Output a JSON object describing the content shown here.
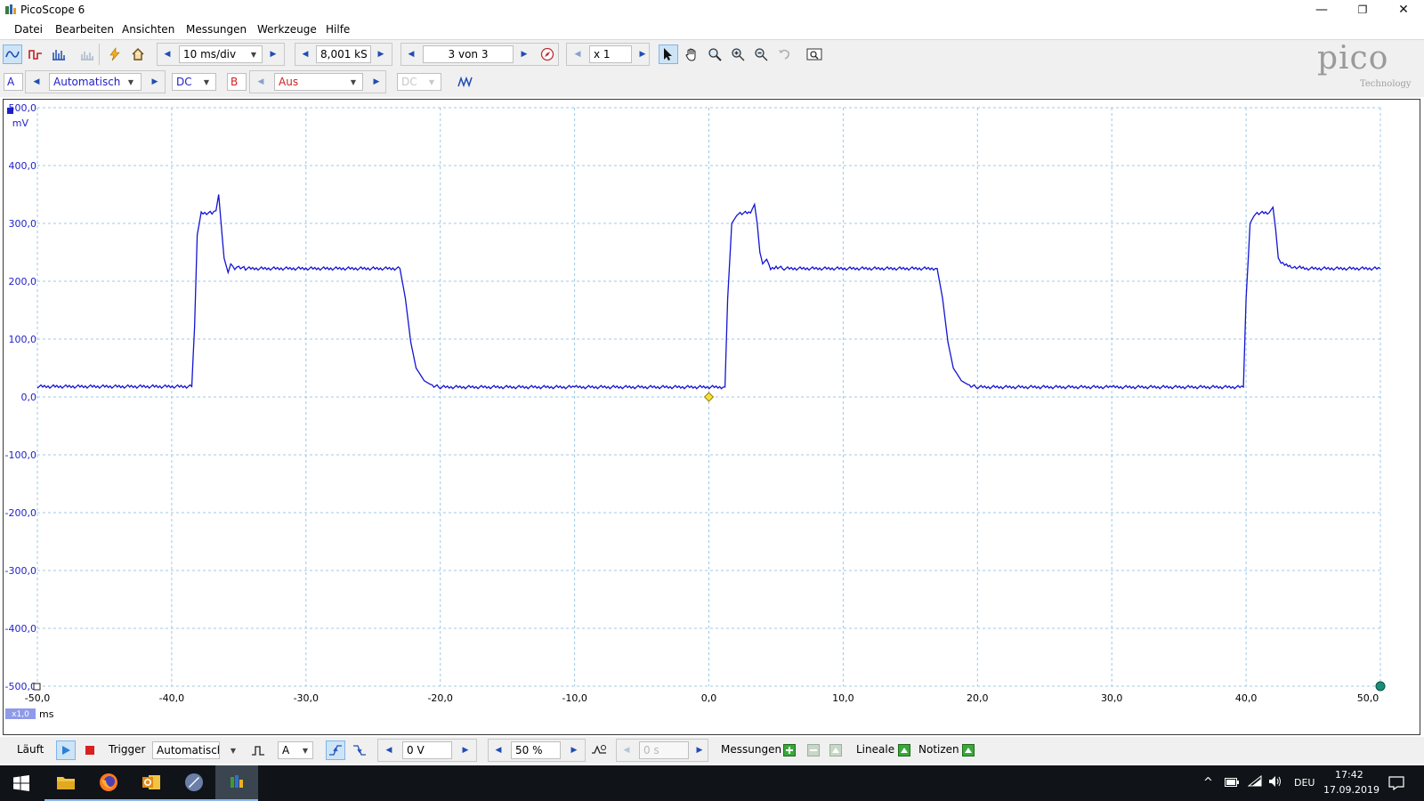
{
  "window": {
    "title": "PicoScope 6"
  },
  "menu": [
    "Datei",
    "Bearbeiten",
    "Ansichten",
    "Messungen",
    "Werkzeuge",
    "Hilfe"
  ],
  "toolbar": {
    "timebase": "10 ms/div",
    "samples": "8,001 kS",
    "buffer": "3 von 3",
    "zoom": "x 1"
  },
  "channels": {
    "a": {
      "label": "A",
      "range": "Automatisch",
      "coupling": "DC",
      "color": "#1f1fc8"
    },
    "b": {
      "label": "B",
      "range": "Aus",
      "coupling": "DC",
      "color": "#d02020"
    }
  },
  "logo": {
    "main": "pico",
    "sub": "Technology"
  },
  "chart_data": {
    "type": "line",
    "ylabel": "mV",
    "xlabel": "ms",
    "xlim": [
      -50,
      50
    ],
    "ylim": [
      -500,
      500
    ],
    "x_ticks": [
      "-50,0",
      "-40,0",
      "-30,0",
      "-20,0",
      "-10,0",
      "0,0",
      "10,0",
      "20,0",
      "30,0",
      "40,0",
      "50,0"
    ],
    "y_ticks": [
      "500,0",
      "400,0",
      "300,0",
      "200,0",
      "100,0",
      "0,0",
      "-100,0",
      "-200,0",
      "-300,0",
      "-400,0",
      "-500,0"
    ],
    "x_scale_badge": "x1,0",
    "grid": true,
    "trigger_marker": [
      0,
      0
    ],
    "series": [
      {
        "color": "#1414d2",
        "x": [
          -50,
          -38.5,
          -38.3,
          -38.1,
          -37.8,
          -37,
          -36.7,
          -36.5,
          -36.3,
          -36.1,
          -35.8,
          -35.6,
          -35.3,
          -35,
          -34.5,
          -23,
          -22.6,
          -22.2,
          -21.8,
          -21.2,
          -20.6,
          -20,
          -10,
          1.2,
          1.4,
          1.7,
          2.2,
          3.1,
          3.4,
          3.6,
          3.8,
          4,
          4.3,
          4.6,
          5,
          5.6,
          17,
          17.4,
          17.8,
          18.2,
          18.8,
          19.4,
          20,
          30,
          39.8,
          40,
          40.3,
          40.7,
          41.7,
          42,
          42.2,
          42.4,
          42.6,
          43,
          43.5,
          44.5,
          50
        ],
        "y": [
          18,
          18,
          120,
          280,
          318,
          318,
          322,
          350,
          295,
          240,
          215,
          230,
          222,
          225,
          222,
          222,
          170,
          95,
          50,
          28,
          20,
          17,
          17,
          17,
          170,
          300,
          318,
          318,
          333,
          300,
          250,
          230,
          238,
          222,
          225,
          222,
          222,
          170,
          95,
          50,
          28,
          20,
          17,
          17,
          17,
          170,
          300,
          318,
          318,
          328,
          290,
          240,
          232,
          228,
          225,
          222,
          222
        ]
      }
    ]
  },
  "bottombar": {
    "status": "Läuft",
    "trigger_label": "Trigger",
    "trigger_mode": "Automatisch",
    "trigger_channel": "A",
    "threshold": "0 V",
    "pretrigger": "50 %",
    "delay": "0 s",
    "measurements": "Messungen",
    "rulers": "Lineale",
    "notes": "Notizen"
  },
  "taskbar": {
    "lang": "DEU",
    "time": "17:42",
    "date": "17.09.2019"
  }
}
